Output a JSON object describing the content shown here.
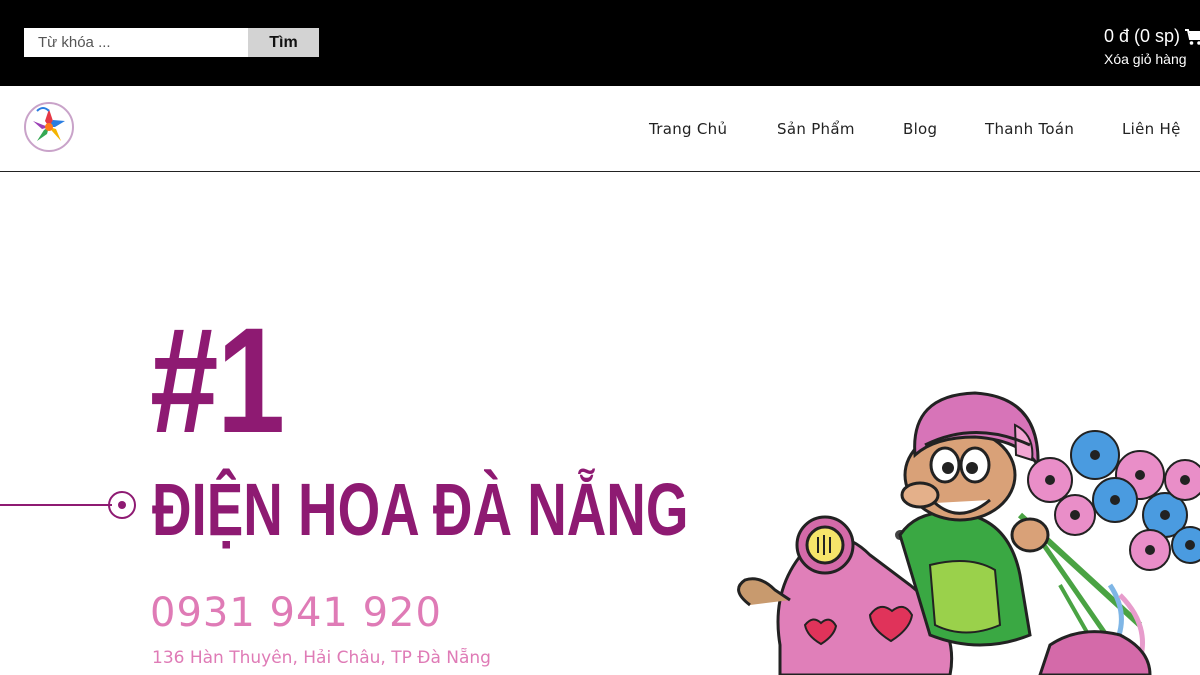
{
  "search": {
    "placeholder": "Từ khóa ...",
    "button_label": "Tìm"
  },
  "cart": {
    "total": "0 đ (0 sp)",
    "clear_label": "Xóa giỏ hàng",
    "icon": "cart-icon"
  },
  "nav": {
    "logo": "flower-logo",
    "items": [
      {
        "label": "Trang Chủ"
      },
      {
        "label": "Sản Phẩm"
      },
      {
        "label": "Blog"
      },
      {
        "label": "Thanh Toán"
      },
      {
        "label": "Liên Hệ"
      }
    ]
  },
  "hero": {
    "rank": "#1",
    "title": "ĐIỆN HOA ĐÀ NẴNG",
    "phone": "0931 941 920",
    "address": "136 Hàn Thuyên, Hải Châu, TP Đà Nẵng"
  },
  "colors": {
    "topbar": "#000000",
    "brand_purple": "#8e1a72",
    "brand_pink": "#df7bb6"
  }
}
